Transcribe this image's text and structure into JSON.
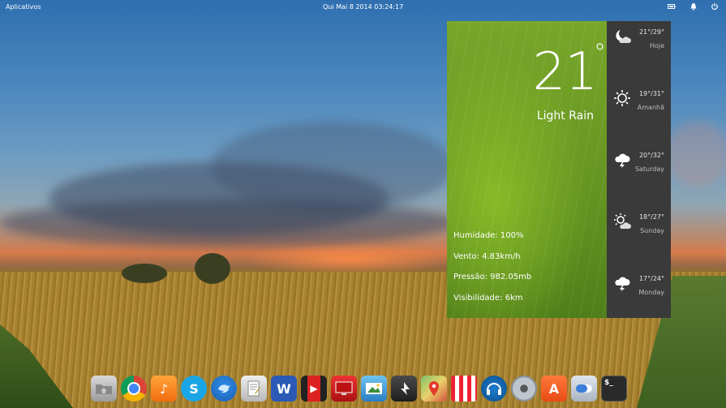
{
  "panel": {
    "apps_label": "Aplicativos",
    "clock": "Qui Mai  8 2014    03:24:17",
    "indicators": [
      "battery-icon",
      "notification-bell-icon",
      "power-icon"
    ]
  },
  "weather": {
    "temperature": "21",
    "degree_symbol": "°",
    "condition": "Light Rain",
    "details": [
      "Humidade:  100%",
      "Vento:  4.83km/h",
      "Pressão:  982.05mb",
      "Visibilidade:  6km"
    ],
    "forecast": [
      {
        "icon": "moon-cloud-icon",
        "range": "21°/29°",
        "day": "Hoje"
      },
      {
        "icon": "sun-icon",
        "range": "19°/31°",
        "day": "Amanhã"
      },
      {
        "icon": "storm-cloud-icon",
        "range": "20°/32°",
        "day": "Saturday"
      },
      {
        "icon": "sun-cloud-icon",
        "range": "18°/27°",
        "day": "Sunday"
      },
      {
        "icon": "storm-cloud-icon",
        "range": "17°/24°",
        "day": "Monday"
      }
    ]
  },
  "dock": {
    "apps": [
      {
        "name": "files-icon"
      },
      {
        "name": "chrome-icon"
      },
      {
        "name": "music-icon",
        "glyph": "♪"
      },
      {
        "name": "skype-icon",
        "glyph": "S"
      },
      {
        "name": "twitter-client-icon"
      },
      {
        "name": "text-editor-icon"
      },
      {
        "name": "word-processor-icon",
        "glyph": "W"
      },
      {
        "name": "video-player-icon",
        "glyph": "▶"
      },
      {
        "name": "screen-recorder-icon"
      },
      {
        "name": "photos-icon"
      },
      {
        "name": "inkscape-icon"
      },
      {
        "name": "maps-icon"
      },
      {
        "name": "popcorn-time-icon"
      },
      {
        "name": "audio-headset-icon"
      },
      {
        "name": "disk-utility-icon"
      },
      {
        "name": "app-store-icon",
        "glyph": "A"
      },
      {
        "name": "settings-toggle-icon"
      },
      {
        "name": "terminal-icon",
        "glyph": "$_"
      }
    ]
  }
}
